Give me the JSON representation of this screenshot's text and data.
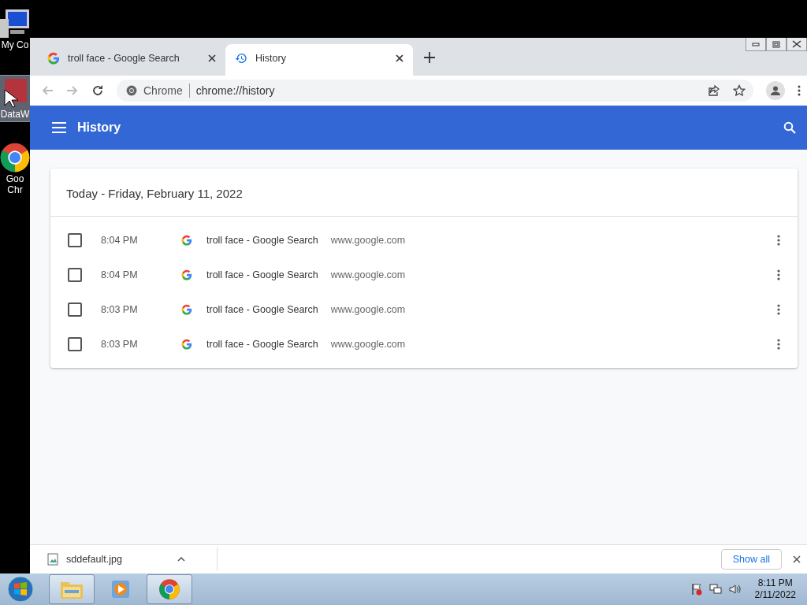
{
  "desktop": {
    "icons": [
      {
        "kind": "computer",
        "lines": [
          "My Co"
        ],
        "selected": false
      },
      {
        "kind": "app",
        "lines": [
          "DataW"
        ],
        "selected": true
      },
      {
        "kind": "chrome",
        "lines": [
          "Goo",
          "Chr"
        ],
        "selected": false
      }
    ]
  },
  "browser": {
    "tabs": [
      {
        "kind": "google",
        "title": "troll face - Google Search",
        "selected": false
      },
      {
        "kind": "history",
        "title": "History",
        "selected": true
      }
    ],
    "address": {
      "site": "Chrome",
      "url": "chrome://history"
    },
    "header": {
      "title": "History"
    },
    "card": {
      "heading": "Today - Friday, February 11, 2022",
      "rows": [
        {
          "checked": false,
          "time": "8:04 PM",
          "title": "troll face - Google Search",
          "domain": "www.google.com"
        },
        {
          "checked": false,
          "time": "8:04 PM",
          "title": "troll face - Google Search",
          "domain": "www.google.com"
        },
        {
          "checked": false,
          "time": "8:03 PM",
          "title": "troll face - Google Search",
          "domain": "www.google.com"
        },
        {
          "checked": false,
          "time": "8:03 PM",
          "title": "troll face - Google Search",
          "domain": "www.google.com"
        }
      ]
    },
    "download_bar": {
      "file": "sddefault.jpg",
      "button": "Show all"
    }
  },
  "taskbar": {
    "apps": [
      {
        "kind": "folder",
        "running": true
      },
      {
        "kind": "media",
        "running": false
      },
      {
        "kind": "chrome",
        "running": true
      }
    ],
    "clock": {
      "time": "8:11 PM",
      "date": "2/11/2022"
    }
  }
}
